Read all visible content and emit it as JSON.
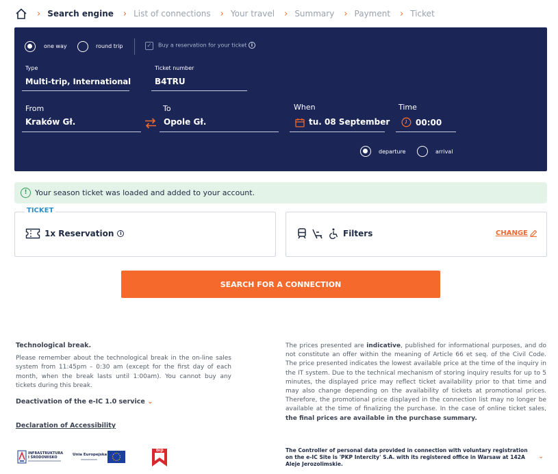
{
  "breadcrumb": {
    "items": [
      {
        "label": "Search engine",
        "active": true
      },
      {
        "label": "List of connections",
        "active": false
      },
      {
        "label": "Your travel",
        "active": false
      },
      {
        "label": "Summary",
        "active": false
      },
      {
        "label": "Payment",
        "active": false
      },
      {
        "label": "Ticket",
        "active": false
      }
    ]
  },
  "search": {
    "trip_one_way": "one way",
    "trip_round": "round trip",
    "reservation_checkbox": "Buy a reservation for your ticket",
    "type_label": "Type",
    "type_value": "Multi-trip, International",
    "ticket_number_label": "Ticket number",
    "ticket_number_value": "B4TRU",
    "from_label": "From",
    "from_value": "Kraków Gł.",
    "to_label": "To",
    "to_value": "Opole Gł.",
    "when_label": "When",
    "when_value": "tu. 08 September",
    "time_label": "Time",
    "time_value": "00:00",
    "departure": "departure",
    "arrival": "arrival"
  },
  "notice": {
    "text": "Your season ticket was loaded and added to your account."
  },
  "ticket": {
    "legend": "TICKET",
    "reservation": "1x Reservation",
    "filters": "Filters",
    "change": "CHANGE"
  },
  "search_button": "SEARCH FOR A CONNECTION",
  "footer": {
    "break_title": "Technological break.",
    "break_text": "Please remember about the technological break in the on-line sales system from 11:45pm – 0:30 am (except for the first day of each month, when the break lasts until 1:00am). You cannot buy any tickets during this break.",
    "deactivation": "Deactivation of the e-IC 1.0 service",
    "accessibility": "Declaration of Accessibility",
    "prices_a": "The prices presented are ",
    "prices_b": "indicative",
    "prices_c": ", published for informational purposes, and do not constitute an offer within the meaning of Article 66 et seq. of the Civil Code. The price presented indicates the lowest available price at the time of the inquiry in the IT system. Due to the technical mechanism of storing inquiry results for up to 5 minutes, the displayed price may reflect ticket availability prior to that time and may also change depending on the availability of tickets at promotional prices. Therefore, the promotional price displayed in the connection list may no longer be available at the time of finalizing the purchase. In the case of online ticket sales, ",
    "prices_d": "the final prices are available in the purchase summary.",
    "gdpr": "The Controller of personal data provided in connection with voluntary registration on the e-IC Site is 'PKP Intercity' S.A. with its registered office in Warsaw at 142A Aleje Jerozolimskie.",
    "logo1_line1": "INFRASTRUKTURA",
    "logo1_line2": "I ŚRODOWISKO",
    "logo2": "Unia Europejska",
    "logo3": "bip"
  },
  "colors": {
    "panel": "#1b2656",
    "accent": "#f5692c",
    "notice_bg": "#e3f3e8",
    "legend": "#2a8fc4"
  }
}
